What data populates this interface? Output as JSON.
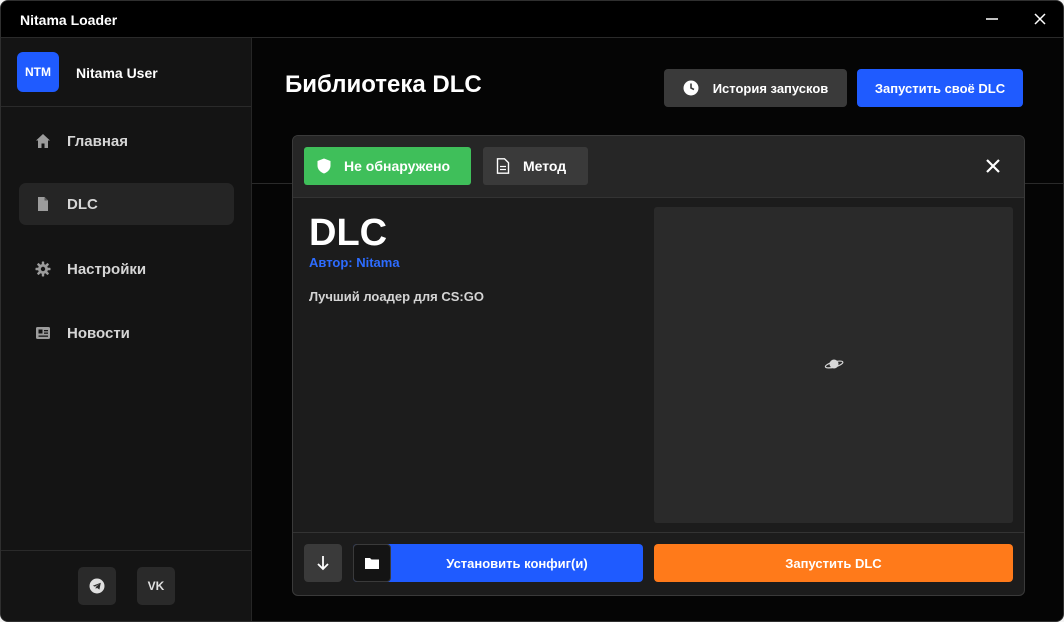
{
  "window": {
    "title": "Nitama Loader"
  },
  "user": {
    "avatar_text": "NTM",
    "name": "Nitama User"
  },
  "sidebar": {
    "items": [
      {
        "label": "Главная",
        "icon": "home-icon"
      },
      {
        "label": "DLC",
        "icon": "file-icon",
        "active": true
      },
      {
        "label": "Настройки",
        "icon": "gear-icon"
      },
      {
        "label": "Новости",
        "icon": "newspaper-icon"
      }
    ],
    "social": [
      {
        "icon": "telegram-icon"
      },
      {
        "icon": "vk-icon",
        "text": "VK"
      }
    ]
  },
  "main": {
    "title": "Библиотека DLC",
    "history_button": "История запусков",
    "own_dlc_button": "Запустить своё DLC"
  },
  "modal": {
    "status_tag": "Не обнаружено",
    "method_tag": "Метод",
    "dlc_name": "DLC",
    "author": "Автор: Nitama",
    "description": "Лучший лоадер для CS:GO",
    "install_button": "Установить конфиг(и)",
    "launch_button": "Запустить DLC"
  },
  "colors": {
    "accent_blue": "#1f5bff",
    "status_green": "#3fbf5a",
    "launch_orange": "#ff7a1a",
    "author_blue": "#2d6cff"
  }
}
